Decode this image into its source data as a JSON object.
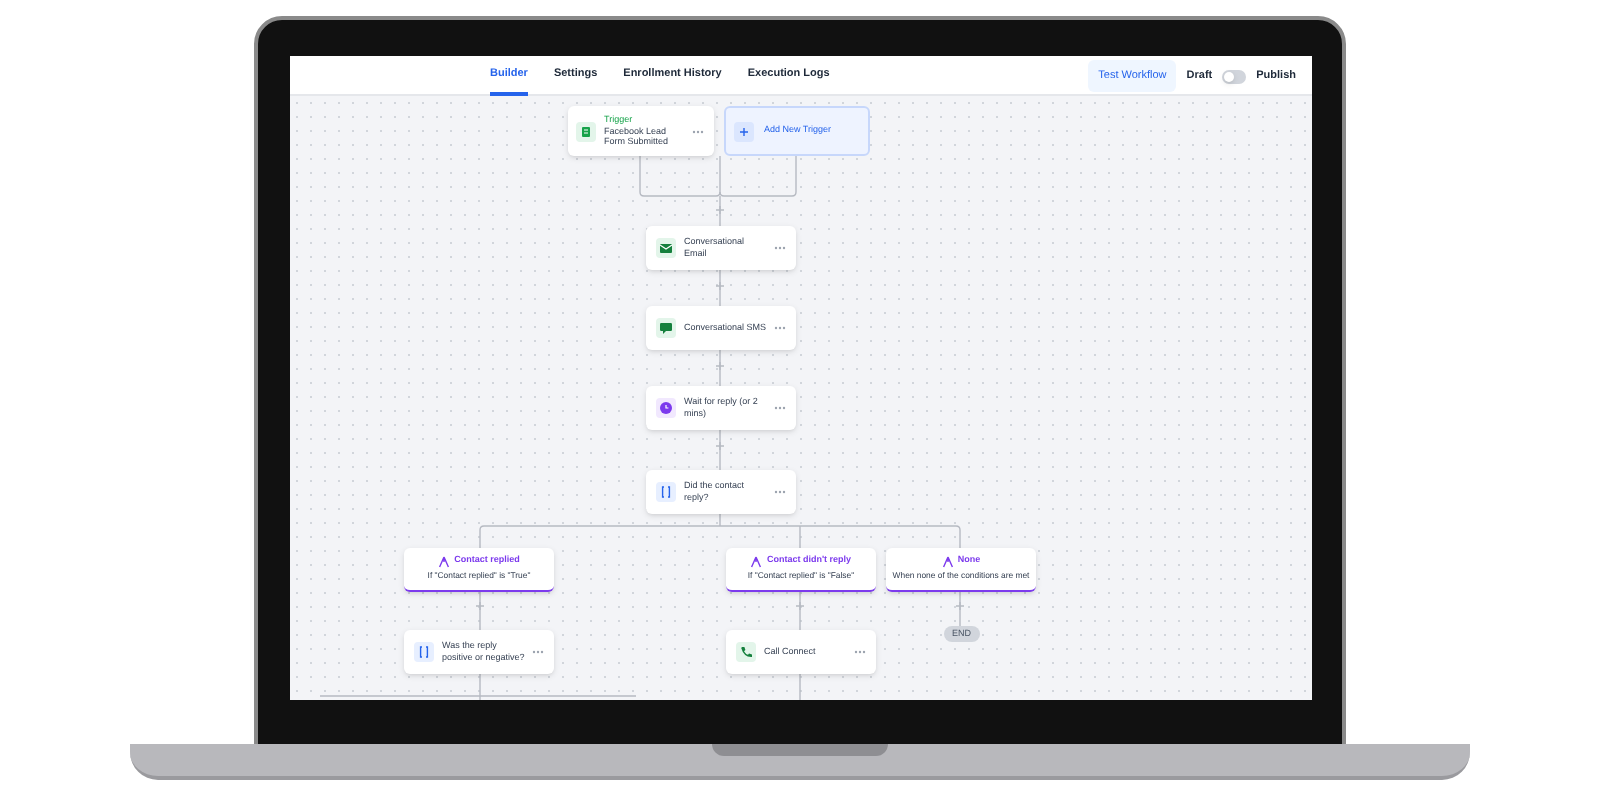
{
  "nav": {
    "tabs": [
      {
        "label": "Builder",
        "selected": true
      },
      {
        "label": "Settings",
        "selected": false
      },
      {
        "label": "Enrollment History",
        "selected": false
      },
      {
        "label": "Execution Logs",
        "selected": false
      }
    ],
    "test_button": "Test Workflow",
    "draft_label": "Draft",
    "publish_toggle": {
      "on": false
    },
    "publish_label": "Publish"
  },
  "trigger": {
    "title": "Trigger",
    "text": "Facebook Lead Form Submitted"
  },
  "add_trigger": "Add New Trigger",
  "steps": [
    {
      "kind": "email",
      "label": "Conversational Email"
    },
    {
      "kind": "sms",
      "label": "Conversational SMS"
    },
    {
      "kind": "wait",
      "label": "Wait for reply (or 2 mins)"
    },
    {
      "kind": "condition",
      "label": "Did the contact reply?"
    }
  ],
  "branches": [
    {
      "title": "Contact replied",
      "condition": "If \"Contact replied\" is \"True\""
    },
    {
      "title": "Contact didn't reply",
      "condition": "If \"Contact replied\" is \"False\""
    },
    {
      "title": "None",
      "condition": "When none of the conditions are met"
    }
  ],
  "branch_steps": [
    {
      "kind": "condition",
      "label": "Was the reply positive or negative?"
    },
    {
      "kind": "call",
      "label": "Call Connect"
    },
    {
      "kind": "end",
      "label": "END"
    }
  ]
}
